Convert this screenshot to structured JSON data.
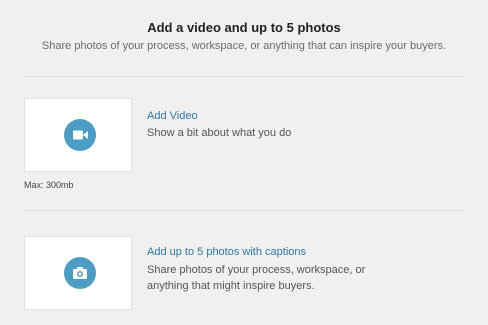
{
  "header": {
    "title": "Add a video and up to 5 photos",
    "subtitle": "Share photos of your process, workspace, or anything that can inspire your buyers."
  },
  "video_section": {
    "icon": "video-camera-icon",
    "link_label": "Add Video",
    "description": "Show a bit about what you do",
    "max_label": "Max: 300mb"
  },
  "photo_section": {
    "icon": "camera-icon",
    "link_label": "Add up to 5 photos with captions",
    "description_line1": "Share photos of your process, workspace, or",
    "description_line2": "anything that might inspire buyers."
  },
  "colors": {
    "background": "#f0f0ee",
    "accent_icon": "#4c9dc3",
    "link": "#2d78a6"
  }
}
